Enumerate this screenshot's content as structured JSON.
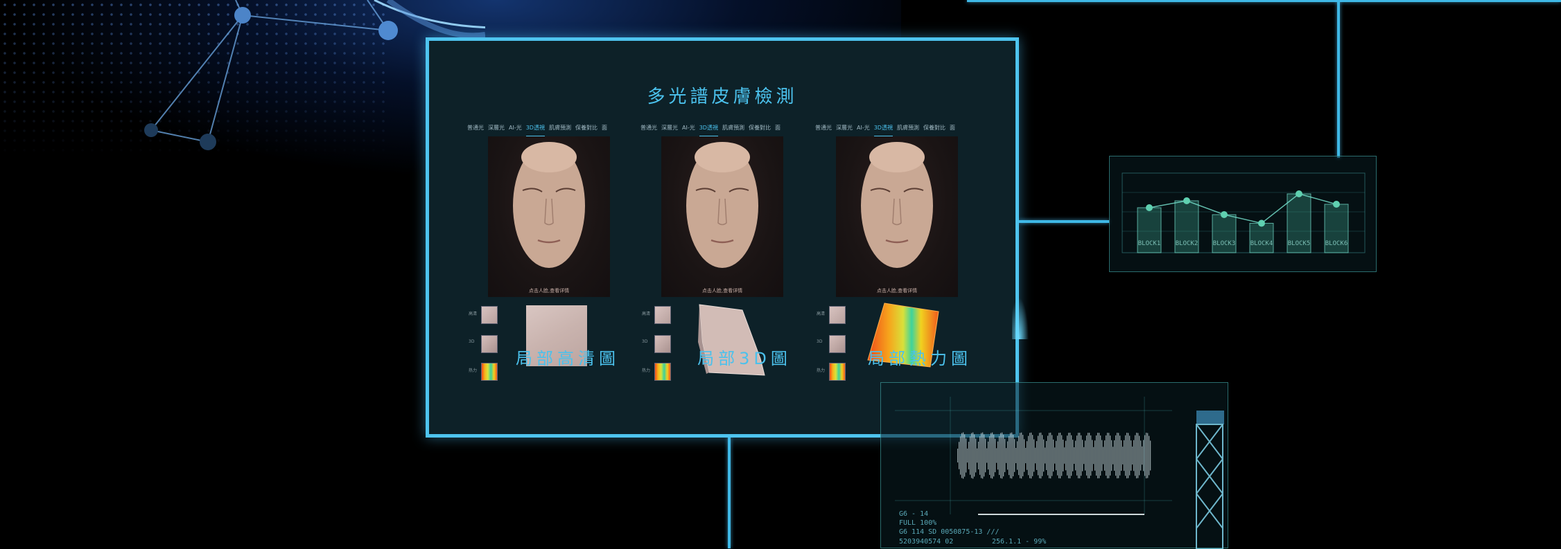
{
  "title": "多光譜皮膚檢測",
  "tabs": [
    "普通光",
    "深層光",
    "AI-光",
    "3D透視",
    "肌膚預測",
    "保養對比",
    "面"
  ],
  "active_tab": "3D透視",
  "face_caption": "点击人脸,查看详情",
  "thumb_labels": [
    "高清",
    "3D",
    "热力"
  ],
  "detail_labels": {
    "hd": "局部高清圖",
    "three_d": "局部3D圖",
    "heat": "局部熱力圖"
  },
  "hud_chart": {
    "blocks": [
      "BLOCK1",
      "BLOCK2",
      "BLOCK3",
      "BLOCK4",
      "BLOCK5",
      "BLOCK6"
    ],
    "values": [
      52,
      60,
      44,
      34,
      68,
      56
    ]
  },
  "hud_waveform": {
    "lines": [
      "G6 - 14",
      "FULL 100%",
      "G6 114 SD 0050875-13  ///",
      "5203940574 02",
      "256.1.1 - 99%"
    ]
  },
  "colors": {
    "accent": "#4ec4ef",
    "panel_bg": "#0d2128",
    "hud": "#5aa9b8"
  }
}
